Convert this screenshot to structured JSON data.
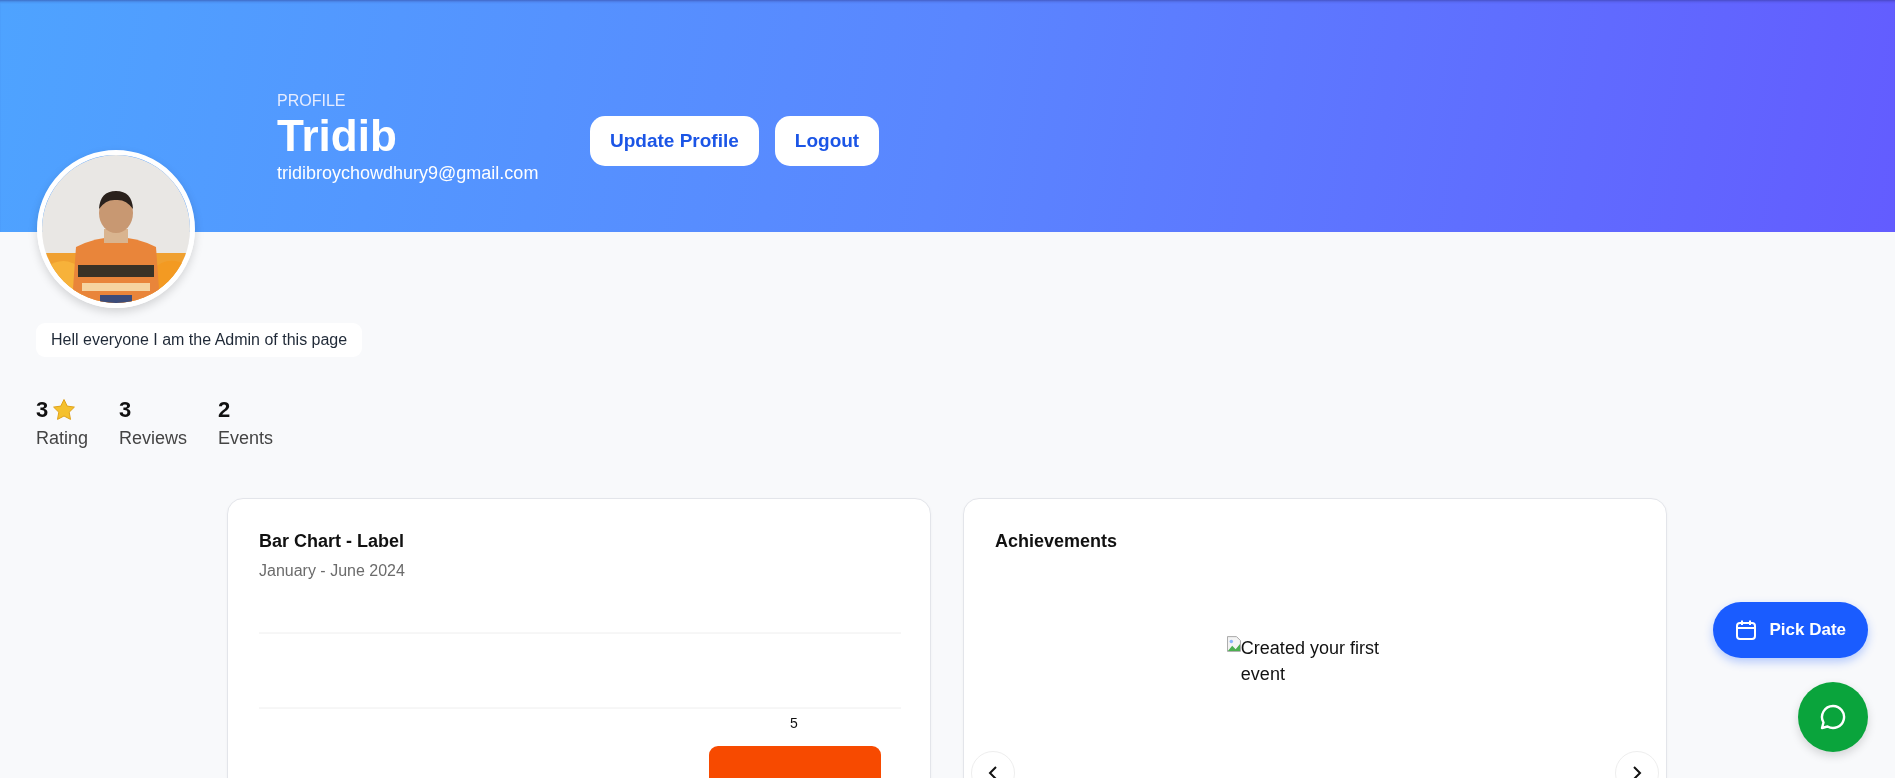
{
  "header": {
    "eyebrow": "PROFILE",
    "name": "Tridib",
    "email": "tridibroychowdhury9@gmail.com",
    "buttons": [
      "Update Profile",
      "Logout"
    ]
  },
  "bio": "Hell everyone I am the Admin of this page",
  "stats": [
    {
      "kind": "rating",
      "value": "3",
      "label": "Rating"
    },
    {
      "kind": "count",
      "value": "3",
      "label": "Reviews"
    },
    {
      "kind": "count",
      "value": "2",
      "label": "Events"
    }
  ],
  "chart_card": {
    "title": "Bar Chart - Label",
    "subtitle": "January - June 2024",
    "bar_label": "5"
  },
  "achievements": {
    "title": "Achievements",
    "items": [
      {
        "alt": "Created your first event"
      }
    ]
  },
  "actions": {
    "pick_date": "Pick Date"
  }
}
